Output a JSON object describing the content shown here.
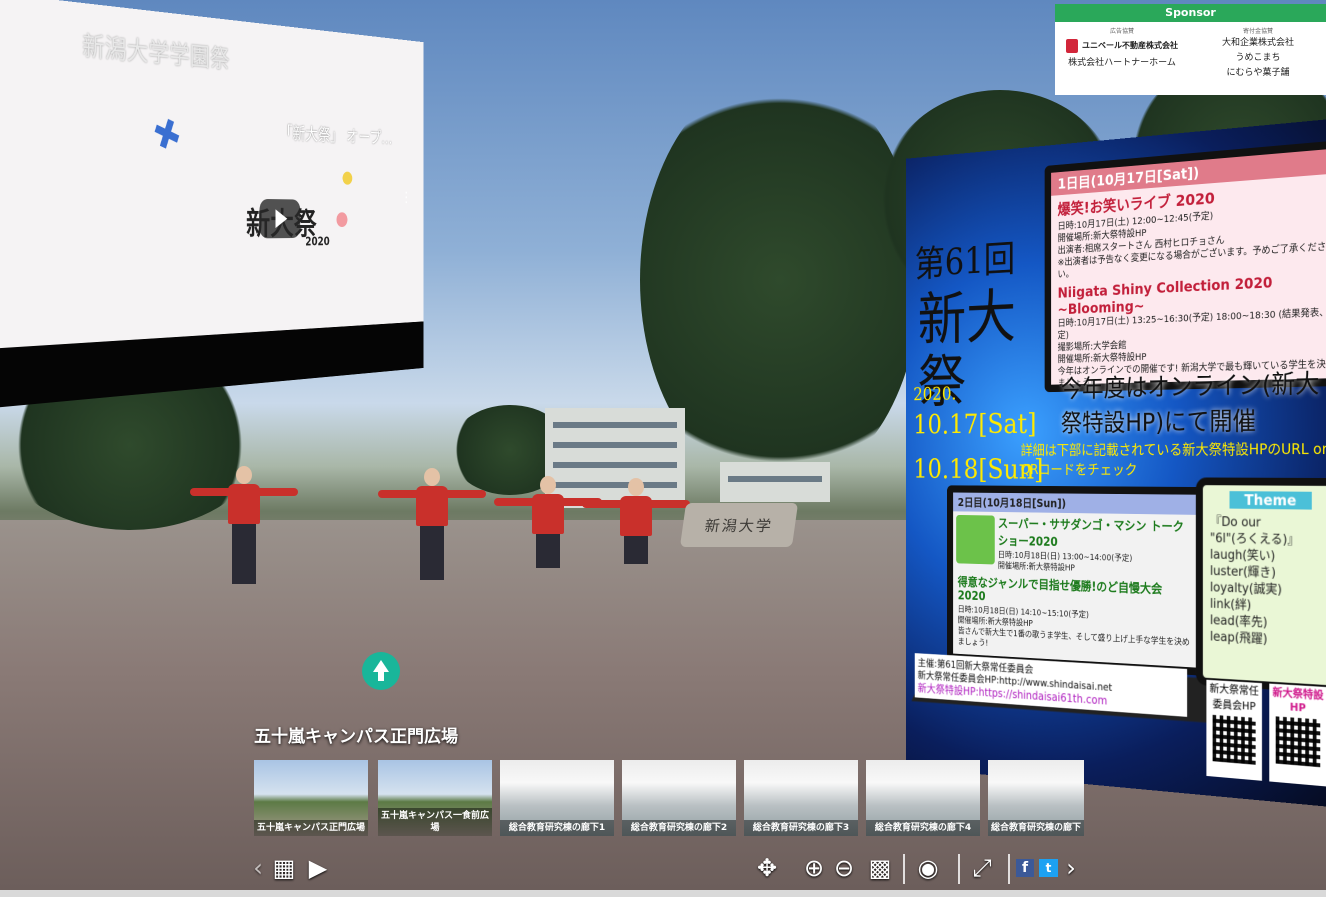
{
  "panorama": {
    "stone_sign": "新潟大学"
  },
  "video": {
    "title": "新潟大学学園祭",
    "title_line2": "「新大祭」 オープ...",
    "logo": "新大祭",
    "logo_year": "2020",
    "more_icon": "kebab-icon"
  },
  "poster": {
    "edition": "第61回",
    "name": "新大祭",
    "year": "2020.",
    "date1": "10.17[Sat]",
    "date2": "10.18[Sun]",
    "online": "今年度はオンライン(新大祭特設HP)にて開催",
    "detail": "詳細は下部に記載されている新大祭特設HPのURL or QRコードをチェック",
    "day1": {
      "header": "1日目(10月17日[Sat])",
      "event1_title": "爆笑!お笑いライブ 2020",
      "event1_lines": [
        "日時:10月17日(土) 12:00~12:45(予定)",
        "開催場所:新大祭特設HP",
        "出演者:相席スタートさん 西村ヒロチョさん",
        "※出演者は予告なく変更になる場合がございます。予めご了承ください。"
      ],
      "event2_title": "Niigata Shiny Collection 2020 ~Blooming~",
      "event2_lines": [
        "日時:10月17日(土) 13:25~16:30(予定) 18:00~18:30 (結果発表、予定)",
        "撮影場所:大学会館",
        "開催場所:新大祭特設HP",
        "今年はオンラインでの開催です! 新潟大学で最も輝いている学生を決めましょう!"
      ]
    },
    "day2": {
      "header": "2日目(10月18日[Sun])",
      "event1_title": "スーパー・ササダンゴ・マシン トークショー2020",
      "event1_lines": [
        "日時:10月18日(日) 13:00~14:00(予定)",
        "開催場所:新大祭特設HP"
      ],
      "event2_title": "得意なジャンルで目指せ優勝!のど自慢大会2020",
      "event2_lines": [
        "日時:10月18日(日) 14:10~15:10(予定)",
        "開催場所:新大祭特設HP",
        "皆さんで新大生で1番の歌うま学生、そして盛り上げ上手な学生を決めましょう!"
      ]
    },
    "theme": {
      "header": "Theme",
      "lines": [
        "『Do our",
        "\"6l\"(ろくえる)』",
        "laugh(笑い)",
        "luster(輝き)",
        "loyalty(誠実)",
        "link(絆)",
        "lead(率先)",
        "leap(飛躍)"
      ]
    },
    "footer": {
      "line1": "主催:第61回新大祭常任委員会",
      "line2": "新大祭常任委員会HP:http://www.shindaisai.net",
      "line3": "新大祭特設HP:https://shindaisai61th.com"
    },
    "qr1_label": "新大祭常任委員会HP",
    "qr2_label": "新大祭特設HP"
  },
  "sponsor": {
    "header": "Sponsor",
    "left_label": "広告協賛",
    "left_items": [
      "ユニベール不動産株式会社",
      "株式会社ハートナーホーム"
    ],
    "right_label": "寄付金協賛",
    "right_items": [
      "大和企業株式会社",
      "うめこまち",
      "にむらや菓子舗"
    ]
  },
  "location": {
    "title": "五十嵐キャンパス正門広場"
  },
  "thumbnails": [
    {
      "caption": "五十嵐キャンパス正門広場",
      "kind": "outdoor"
    },
    {
      "caption": "五十嵐キャンパス一食前広場",
      "kind": "outdoor"
    },
    {
      "caption": "総合教育研究棟の廊下1",
      "kind": "hall"
    },
    {
      "caption": "総合教育研究棟の廊下2",
      "kind": "hall"
    },
    {
      "caption": "総合教育研究棟の廊下3",
      "kind": "hall"
    },
    {
      "caption": "総合教育研究棟の廊下4",
      "kind": "hall"
    },
    {
      "caption": "総合教育研究棟の廊下",
      "kind": "hall"
    }
  ],
  "toolbar": {
    "prev": "‹",
    "grid": "▦",
    "play": "▶",
    "move": "✥",
    "zoom_in": "⊕",
    "zoom_out": "⊖",
    "qr": "▩",
    "vr": "◉",
    "fullscreen": "⤢",
    "facebook": "f",
    "twitter": "t",
    "next": "›"
  }
}
